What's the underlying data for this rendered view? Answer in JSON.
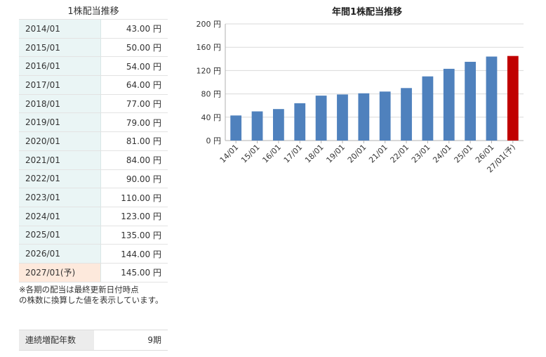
{
  "table": {
    "title": "1株配当推移",
    "rows": [
      {
        "period": "2014/01",
        "amount": "43.00 円"
      },
      {
        "period": "2015/01",
        "amount": "50.00 円"
      },
      {
        "period": "2016/01",
        "amount": "54.00 円"
      },
      {
        "period": "2017/01",
        "amount": "64.00 円"
      },
      {
        "period": "2018/01",
        "amount": "77.00 円"
      },
      {
        "period": "2019/01",
        "amount": "79.00 円"
      },
      {
        "period": "2020/01",
        "amount": "81.00 円"
      },
      {
        "period": "2021/01",
        "amount": "84.00 円"
      },
      {
        "period": "2022/01",
        "amount": "90.00 円"
      },
      {
        "period": "2023/01",
        "amount": "110.00 円"
      },
      {
        "period": "2024/01",
        "amount": "123.00 円"
      },
      {
        "period": "2025/01",
        "amount": "135.00 円"
      },
      {
        "period": "2026/01",
        "amount": "144.00 円"
      },
      {
        "period": "2027/01(予)",
        "amount": "145.00 円",
        "forecast": true
      }
    ],
    "note_line1": "※各期の配当は最終更新日付時点",
    "note_line2": "の株数に換算した値を表示しています。"
  },
  "streak": {
    "label": "連続増配年数",
    "value": "9期"
  },
  "colors": {
    "bar": "#4f81bd",
    "bar_forecast": "#c00000",
    "period_bg": "#eaf5f5",
    "forecast_bg": "#fde9dc"
  },
  "chart_data": {
    "type": "bar",
    "title": "年間1株配当推移",
    "categories": [
      "14/01",
      "15/01",
      "16/01",
      "17/01",
      "18/01",
      "19/01",
      "20/01",
      "21/01",
      "22/01",
      "23/01",
      "24/01",
      "25/01",
      "26/01",
      "27/01(予)"
    ],
    "values": [
      43,
      50,
      54,
      64,
      77,
      79,
      81,
      84,
      90,
      110,
      123,
      135,
      144,
      145
    ],
    "forecast_index": 13,
    "ylim": [
      0,
      200
    ],
    "yticks": [
      0,
      40,
      80,
      120,
      160,
      200
    ],
    "ytick_labels": [
      "0 円",
      "40 円",
      "80 円",
      "120 円",
      "160 円",
      "200 円"
    ],
    "grid": true
  }
}
